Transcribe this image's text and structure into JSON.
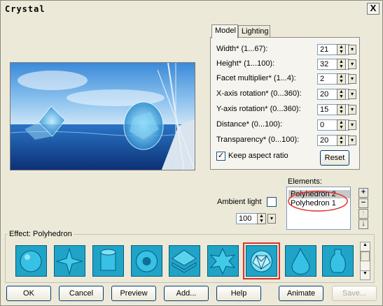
{
  "window": {
    "title": "Crystal",
    "close_glyph": "X"
  },
  "tabs": [
    {
      "label": "Model"
    },
    {
      "label": "Lighting"
    }
  ],
  "fields": [
    {
      "label": "Width* (1...67):",
      "value": "21"
    },
    {
      "label": "Height* (1...100):",
      "value": "32"
    },
    {
      "label": "Facet multiplier* (1...4):",
      "value": "2"
    },
    {
      "label": "X-axis rotation* (0...360):",
      "value": "20"
    },
    {
      "label": "Y-axis rotation* (0...360):",
      "value": "15"
    },
    {
      "label": "Distance* (0...100):",
      "value": "0"
    },
    {
      "label": "Transparency* (0...100):",
      "value": "20"
    }
  ],
  "keep_aspect": {
    "label": "Keep aspect ratio",
    "checked": true,
    "check_glyph": "✓"
  },
  "reset_label": "Reset",
  "ambient": {
    "label": "Ambient light",
    "value": "100"
  },
  "elements": {
    "label": "Elements:",
    "items": [
      {
        "label": "Polyhedron 2"
      },
      {
        "label": "Polyhedron 1"
      }
    ],
    "add_glyph": "+",
    "remove_glyph": "−",
    "up_glyph": "↑",
    "down_glyph": "↓"
  },
  "effect_group_label": "Effect: Polyhedron",
  "effects": [
    {
      "icon": "sphere-icon"
    },
    {
      "icon": "star-icon"
    },
    {
      "icon": "cylinder-icon"
    },
    {
      "icon": "torus-icon"
    },
    {
      "icon": "layered-diamond-icon"
    },
    {
      "icon": "star-burst-icon"
    },
    {
      "icon": "polyhedron-icon",
      "selected": true
    },
    {
      "icon": "droplet-icon"
    },
    {
      "icon": "vase-icon"
    }
  ],
  "buttons": {
    "ok": "OK",
    "cancel": "Cancel",
    "preview": "Preview",
    "add": "Add...",
    "help": "Help",
    "animate": "Animate",
    "save": "Save..."
  },
  "colors": {
    "accent": "#1fa4c8",
    "selection_outline": "#e0312b"
  }
}
